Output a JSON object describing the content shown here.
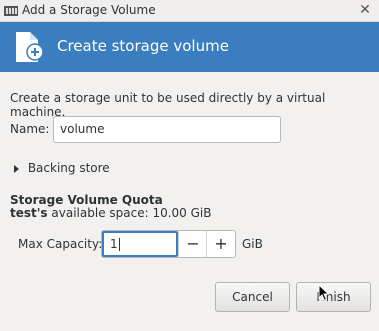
{
  "window": {
    "title": "Add a Storage Volume",
    "close_glyph": "✕"
  },
  "banner": {
    "title": "Create storage volume",
    "icon": "new-file-icon"
  },
  "form": {
    "intro": "Create a storage unit to be used directly by a virtual machine.",
    "name_label": "Name:",
    "name_value": "volume",
    "backing_store_label": "Backing store"
  },
  "quota": {
    "title": "Storage Volume Quota",
    "pool": "test's",
    "available": "available space: 10.00 GiB",
    "max_capacity_label": "Max Capacity:",
    "max_capacity_value": "1",
    "minus": "−",
    "plus": "+",
    "unit": "GiB"
  },
  "buttons": {
    "cancel": "Cancel",
    "finish": "Finish"
  },
  "colors": {
    "accent": "#3a7ec0",
    "background": "#f2f1f0"
  }
}
